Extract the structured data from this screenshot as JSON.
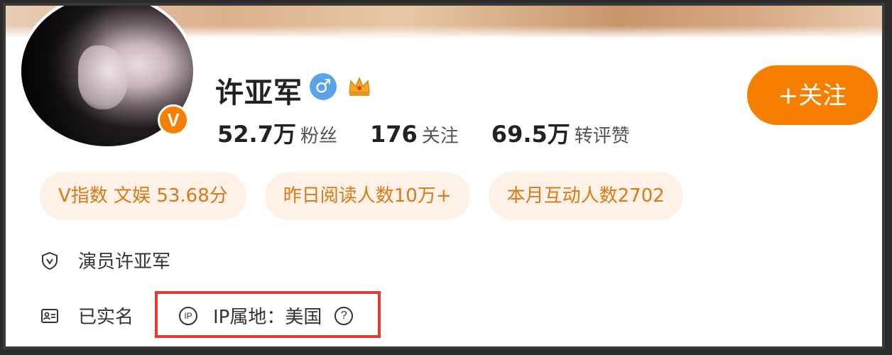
{
  "profile": {
    "name": "许亚军",
    "verified_badge": "V",
    "gender_icon": "♂",
    "vip_icon": "crown-icon"
  },
  "stats": [
    {
      "num": "52.7万",
      "label": "粉丝"
    },
    {
      "num": "176",
      "label": "关注"
    },
    {
      "num": "69.5万",
      "label": "转评赞"
    }
  ],
  "follow_button": {
    "label": "+关注"
  },
  "pills": [
    {
      "text": "V指数 文娱 53.68分"
    },
    {
      "text": "昨日阅读人数10万+"
    },
    {
      "text": "本月互动人数2702"
    }
  ],
  "info": {
    "occupation": "演员许亚军",
    "realname": "已实名",
    "ip_icon": "IP",
    "ip_location": "IP属地：美国",
    "help_icon": "?"
  },
  "colors": {
    "accent": "#f77f00",
    "highlight_box": "#e53a3a",
    "pill_bg": "#fdf1e8",
    "pill_text": "#d97a16"
  }
}
